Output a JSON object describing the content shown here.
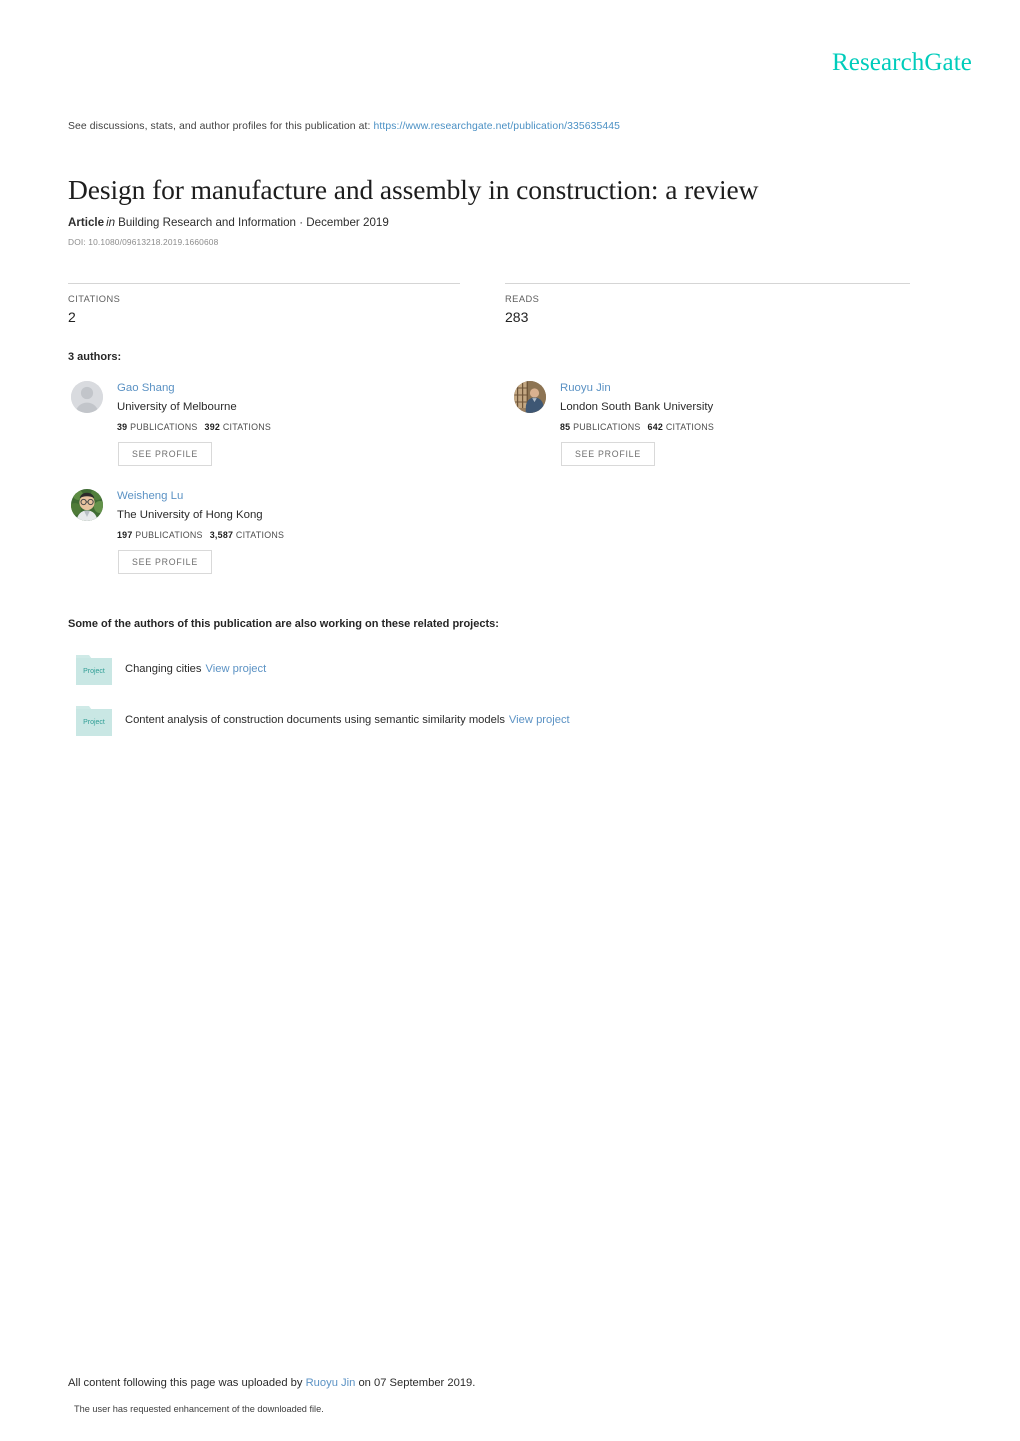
{
  "header": {
    "logo": "ResearchGate"
  },
  "discussion": {
    "prefix": "See discussions, stats, and author profiles for this publication at:",
    "url": "https://www.researchgate.net/publication/335635445"
  },
  "publication": {
    "title": "Design for manufacture and assembly in construction: a review",
    "type_label": "Article",
    "in_word": "in",
    "venue": "Building Research and Information · December 2019",
    "doi": "DOI: 10.1080/09613218.2019.1660608"
  },
  "stats": [
    {
      "label": "CITATIONS",
      "value": "2"
    },
    {
      "label": "READS",
      "value": "283"
    }
  ],
  "authors_section": {
    "heading": "3 authors:",
    "see_profile_label": "SEE PROFILE",
    "publications_label": "PUBLICATIONS",
    "citations_label": "CITATIONS",
    "authors": [
      {
        "name": "Gao Shang",
        "affiliation": "University of Melbourne",
        "publications": "39",
        "citations": "392",
        "avatar": "default-avatar"
      },
      {
        "name": "Ruoyu Jin",
        "affiliation": "London South Bank University",
        "publications": "85",
        "citations": "642",
        "avatar": "photo-bookshelf"
      },
      {
        "name": "Weisheng Lu",
        "affiliation": "The University of Hong Kong",
        "publications": "197",
        "citations": "3,587",
        "avatar": "photo-foliage"
      }
    ]
  },
  "projects_section": {
    "heading": "Some of the authors of this publication are also working on these related projects:",
    "icon_label": "Project",
    "view_label": "View project",
    "projects": [
      {
        "title": "Changing cities"
      },
      {
        "title": "Content analysis of construction documents using semantic similarity models"
      }
    ]
  },
  "footer": {
    "line_prefix": "All content following this page was uploaded by",
    "uploader": "Ruoyu Jin",
    "line_suffix": "on 07 September 2019.",
    "note": "The user has requested enhancement of the downloaded file."
  },
  "colors": {
    "brand_teal": "#00ccbb",
    "link_blue": "#5b92c4",
    "url_blue": "#4a90c4",
    "project_icon": "#c9e7e4"
  }
}
